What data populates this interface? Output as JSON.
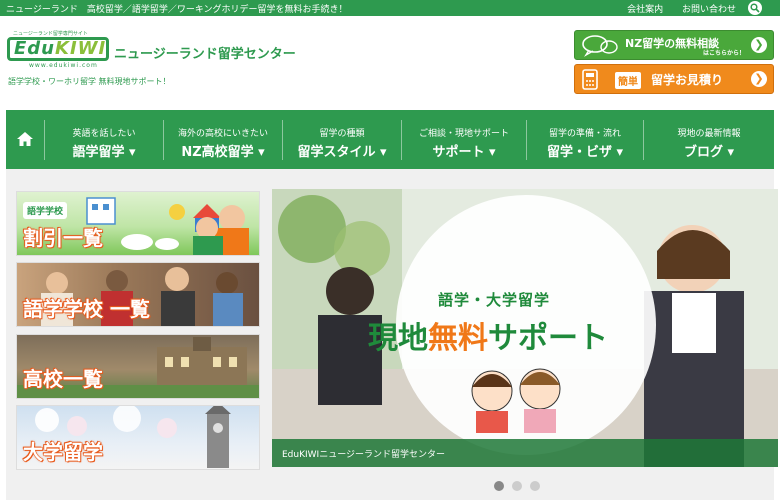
{
  "topbar": {
    "tagline": "ニュージーランド　高校留学／語学留学／ワーキングホリデー留学を無料お手続き！",
    "links": [
      "会社案内",
      "お問い合わせ"
    ],
    "search_icon": "search-icon"
  },
  "header": {
    "logo_sub": "ニュージーランド留学専門サイト",
    "logo_word_a": "Edu",
    "logo_word_b": "KIWI",
    "logo_url": "www.edukiwi.com",
    "site_name": "ニュージーランド留学センター",
    "site_sub": "語学学校・ワーホリ留学 無料現地サポート！"
  },
  "cta": {
    "consult_title": "NZ留学の無料相談",
    "consult_sub": "はこちらから！",
    "estimate_badge": "簡単",
    "estimate_title": "留学お見積り",
    "arrow": "❯"
  },
  "nav": {
    "items": [
      {
        "small": "英語を話したい",
        "large": "語学留学 ▾"
      },
      {
        "small": "海外の高校にいきたい",
        "large": "NZ高校留学 ▾"
      },
      {
        "small": "留学の種類",
        "large": "留学スタイル ▾"
      },
      {
        "small": "ご相談・現地サポート",
        "large": "サポート ▾"
      },
      {
        "small": "留学の準備・流れ",
        "large": "留学・ビザ ▾"
      },
      {
        "small": "現地の最新情報",
        "large": "ブログ ▾"
      }
    ]
  },
  "tiles": [
    {
      "badge": "語学学校",
      "label": "割引一覧"
    },
    {
      "label": "語学学校 一覧"
    },
    {
      "label": "高校一覧"
    },
    {
      "label": "大学留学"
    }
  ],
  "slider": {
    "headline1": "語学・大学留学",
    "headline2_a": "現地",
    "headline2_b": "無料",
    "headline2_c": "サポート",
    "caption": "EduKIWIニュージーランド留学センター",
    "active_slide": 1,
    "slide_count": 3
  },
  "colors": {
    "brand_green": "#2e9a4f",
    "accent_orange": "#f08a1c"
  }
}
